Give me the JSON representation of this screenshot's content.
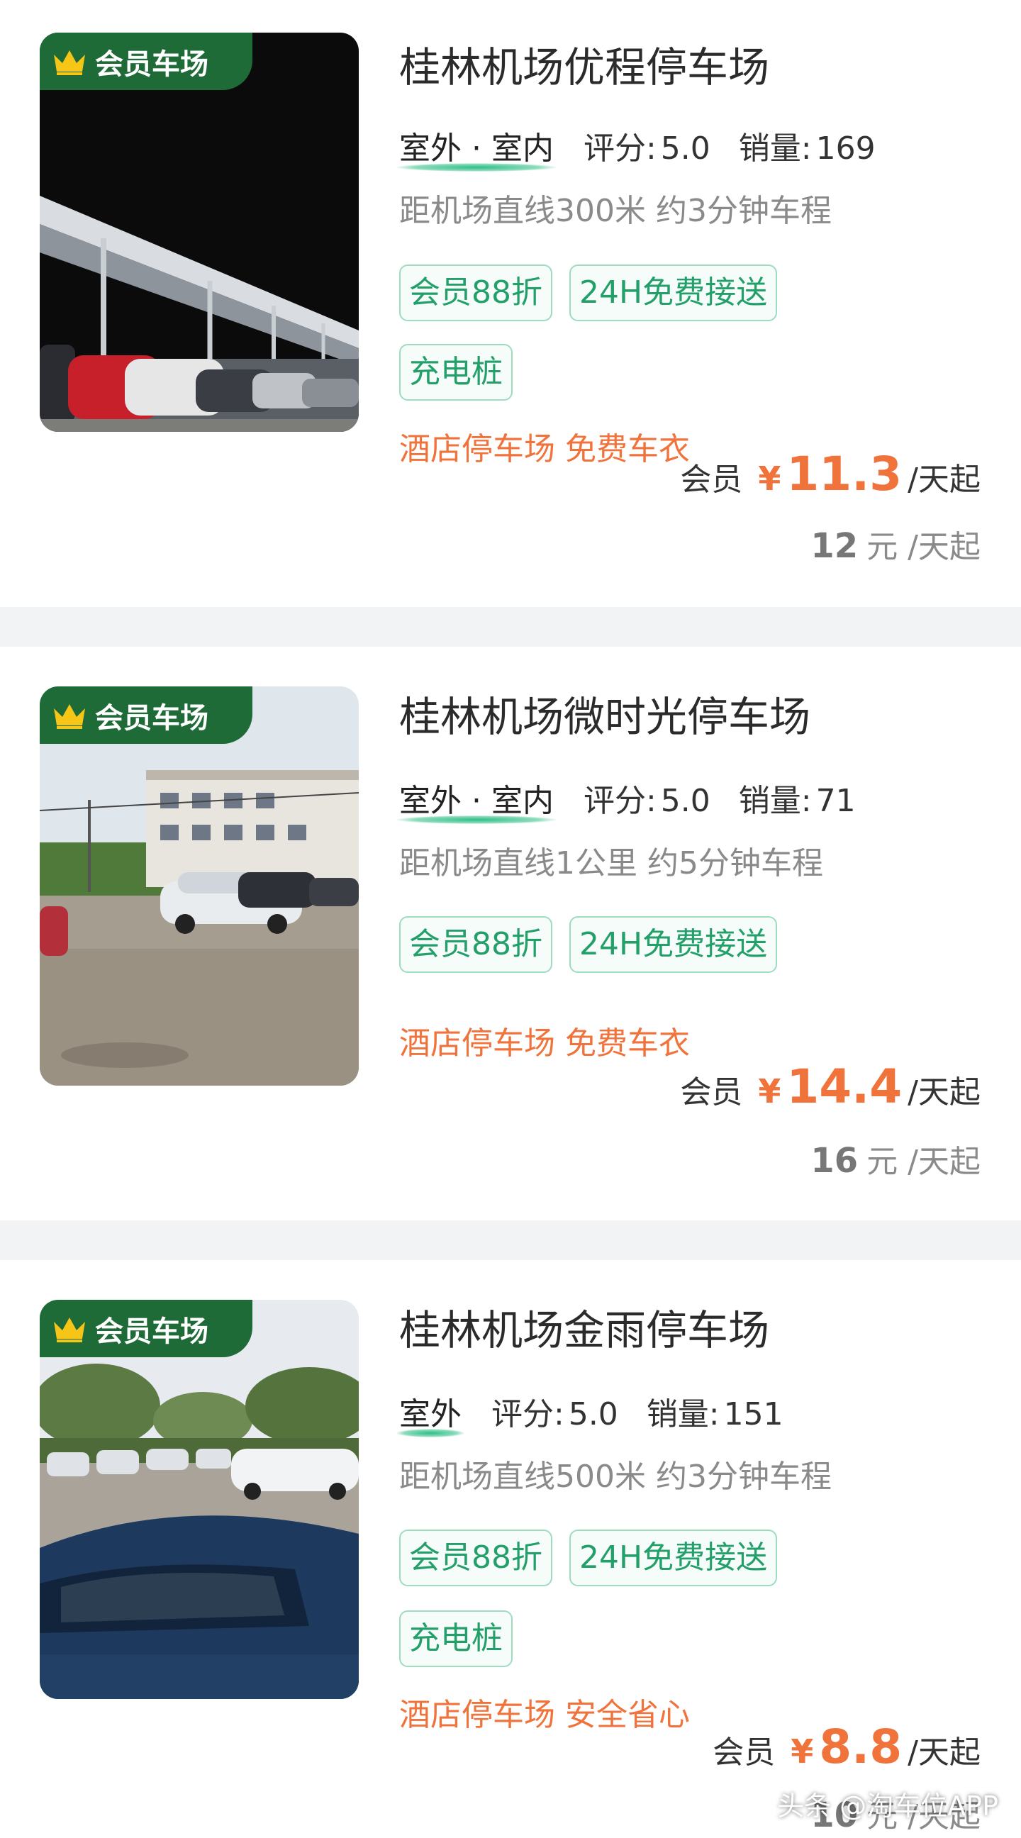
{
  "badge_label": "会员车场",
  "lots": [
    {
      "name": "桂林机场优程停车场",
      "type": "室外 · 室内",
      "rating_label": "评分:",
      "rating": "5.0",
      "sales_label": "销量:",
      "sales": "169",
      "distance": "距机场直线300米 约3分钟车程",
      "tags": [
        "会员88折",
        "24H免费接送",
        "充电桩"
      ],
      "promo": "酒店停车场 免费车衣",
      "member_label": "会员",
      "currency": "¥",
      "member_price": "11.3",
      "unit": "/天起",
      "original_price": "12",
      "original_unit": "元 /天起"
    },
    {
      "name": "桂林机场微时光停车场",
      "type": "室外 · 室内",
      "rating_label": "评分:",
      "rating": "5.0",
      "sales_label": "销量:",
      "sales": "71",
      "distance": "距机场直线1公里 约5分钟车程",
      "tags": [
        "会员88折",
        "24H免费接送"
      ],
      "promo": "酒店停车场 免费车衣",
      "member_label": "会员",
      "currency": "¥",
      "member_price": "14.4",
      "unit": "/天起",
      "original_price": "16",
      "original_unit": "元 /天起"
    },
    {
      "name": "桂林机场金雨停车场",
      "type": "室外",
      "rating_label": "评分:",
      "rating": "5.0",
      "sales_label": "销量:",
      "sales": "151",
      "distance": "距机场直线500米 约3分钟车程",
      "tags": [
        "会员88折",
        "24H免费接送",
        "充电桩"
      ],
      "promo": "酒店停车场 安全省心",
      "member_label": "会员",
      "currency": "¥",
      "member_price": "8.8",
      "unit": "/天起",
      "original_price": "10",
      "original_unit": "元 /天起"
    }
  ],
  "watermark": "头条 @淘车位APP",
  "colors": {
    "accent_green": "#23a06a",
    "badge_green": "#1f6b38",
    "price_orange": "#f0733c",
    "separator": "#f2f3f5"
  }
}
